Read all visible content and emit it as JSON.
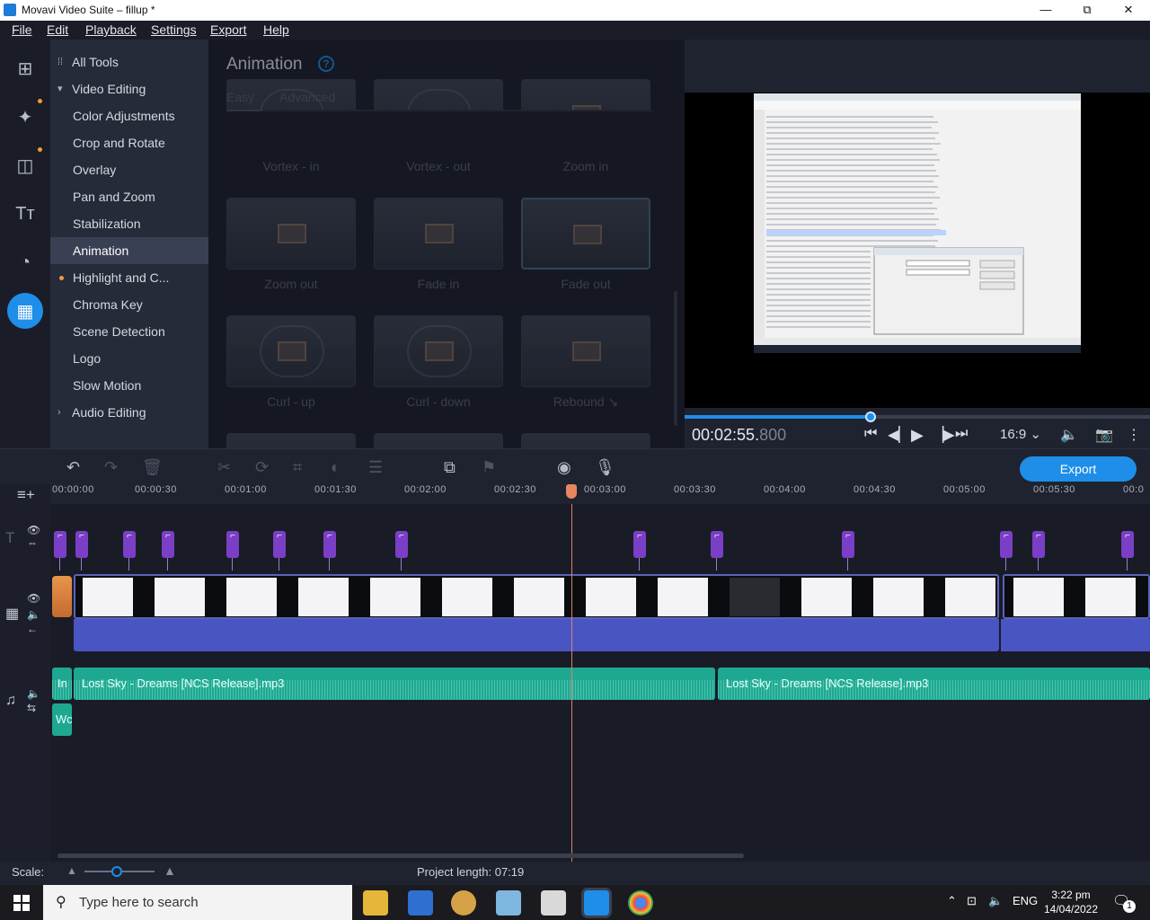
{
  "window": {
    "title": "Movavi Video Suite – fillup *",
    "minimize": "—",
    "maximize": "⧉",
    "close": "✕"
  },
  "menu": [
    "File",
    "Edit",
    "Playback",
    "Settings",
    "Export",
    "Help"
  ],
  "tools": {
    "all_tools": "All Tools",
    "video_editing": "Video Editing",
    "items": [
      "Color Adjustments",
      "Crop and Rotate",
      "Overlay",
      "Pan and Zoom",
      "Stabilization",
      "Animation",
      "Highlight and C...",
      "Chroma Key",
      "Scene Detection",
      "Logo",
      "Slow Motion"
    ],
    "audio_editing": "Audio Editing"
  },
  "panel": {
    "title": "Animation",
    "help": "?",
    "tabs": [
      "Easy",
      "Advanced"
    ],
    "row0": [
      "Vortex - in",
      "Vortex - out",
      "Zoom in"
    ],
    "row1": [
      "Zoom out",
      "Fade in",
      "Fade out"
    ],
    "row2": [
      "Curl - up",
      "Curl - down",
      "Rebound ↘"
    ]
  },
  "preview": {
    "time_main": "00:02:55.",
    "time_ms": "800",
    "aspect": "16:9"
  },
  "timeline": {
    "export_label": "Export",
    "ruler": [
      "00:00:00",
      "00:00:30",
      "00:01:00",
      "00:01:30",
      "00:02:00",
      "00:02:30",
      "00:03:00",
      "00:03:30",
      "00:04:00",
      "00:04:30",
      "00:05:00",
      "00:05:30",
      "00:0"
    ],
    "music_clip_1": "Lost Sky - Dreams [NCS Release].mp3",
    "music_clip_2": "Lost Sky - Dreams [NCS Release].mp3",
    "small_clip_1": "In",
    "small_clip_2": "Wc"
  },
  "bottom": {
    "scale_label": "Scale:",
    "project_length": "Project length:  07:19"
  },
  "taskbar": {
    "search_placeholder": "Type here to search",
    "lang": "ENG",
    "time": "3:22 pm",
    "date": "14/04/2022",
    "notif": "1"
  },
  "colors": {
    "accent": "#1e8ee8",
    "marker": "#7a3fc6",
    "music": "#1fa891",
    "playhead": "#e9865f"
  }
}
